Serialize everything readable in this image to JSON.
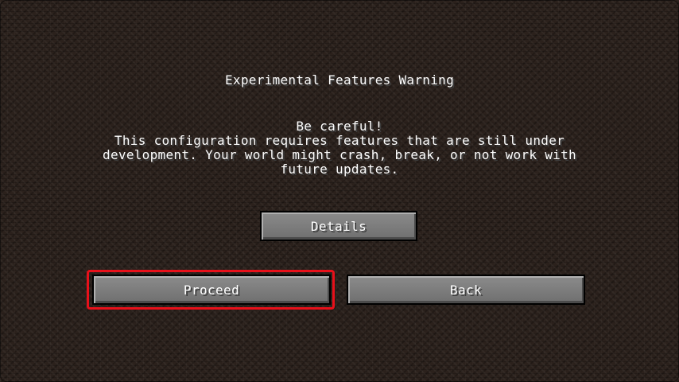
{
  "screen": {
    "title": "Experimental Features Warning",
    "message_lines": [
      "Be careful!",
      "This configuration requires features that are still under",
      "development. Your world might crash, break, or not work with",
      "future updates."
    ]
  },
  "buttons": {
    "details_label": "Details",
    "proceed_label": "Proceed",
    "back_label": "Back"
  },
  "colors": {
    "highlight": "#e8101a",
    "button_face": "#7f7f7f",
    "background": "#2b211c"
  }
}
